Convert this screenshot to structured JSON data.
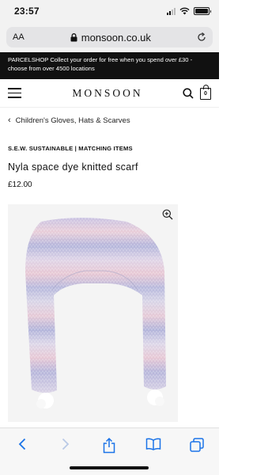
{
  "status_bar": {
    "time": "23:57"
  },
  "browser": {
    "text_size_label": "AA",
    "url": "monsoon.co.uk"
  },
  "promo": {
    "text": "PARCELSHOP Collect your order for free when you spend over £30 - choose from over 4500 locations"
  },
  "header": {
    "logo": "MONSOON",
    "bag_count": "0"
  },
  "breadcrumb": {
    "label": "Children's Gloves, Hats & Scarves"
  },
  "product": {
    "collection": "S.E.W. SUSTAINABLE | MATCHING ITEMS",
    "title": "Nyla space dye knitted scarf",
    "price": "£12.00"
  },
  "colors": {
    "accent": "#1a73e8",
    "promo_bg": "#111111",
    "scarf_lilac": "#b9b5da",
    "scarf_pink": "#e6c9d6"
  },
  "icons": {
    "menu": "menu-icon",
    "search": "search-icon",
    "bag": "bag-icon",
    "zoom": "zoom-icon",
    "lock": "lock-icon",
    "reload": "reload-icon",
    "back": "back-icon",
    "forward": "forward-icon",
    "share": "share-icon",
    "bookmarks": "bookmarks-icon",
    "tabs": "tabs-icon"
  }
}
